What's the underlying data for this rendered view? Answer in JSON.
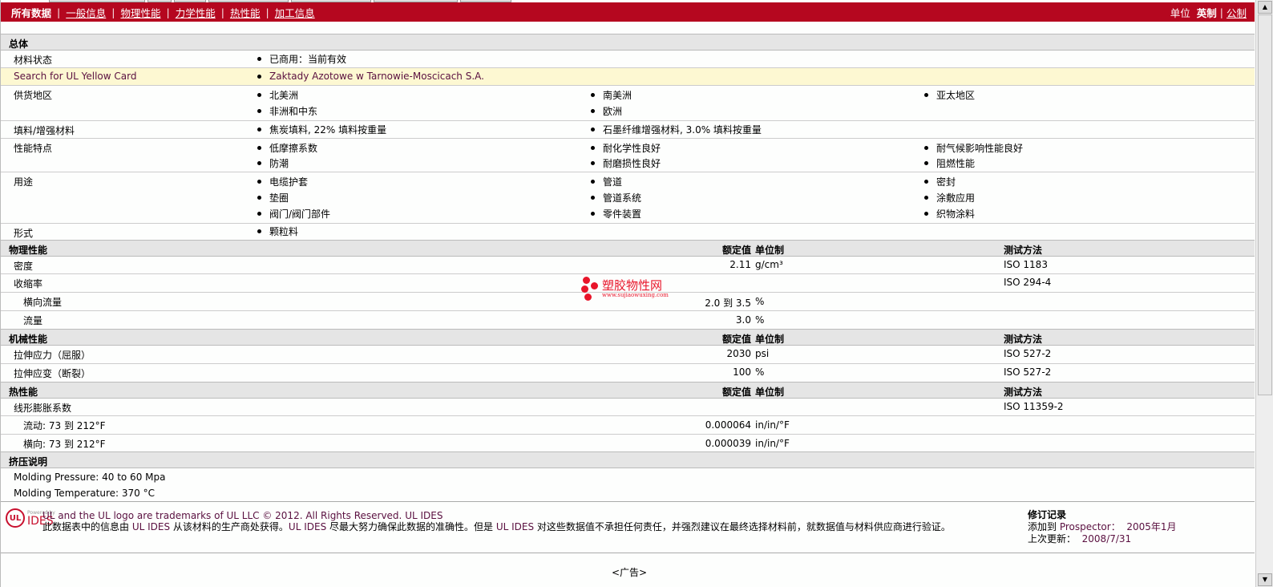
{
  "nav": {
    "items": [
      "所有数据",
      "一般信息",
      "物理性能",
      "力学性能",
      "热性能",
      "加工信息"
    ],
    "units_label": "单位",
    "units_current": "英制",
    "units_other": "公制"
  },
  "general": {
    "title": "总体",
    "status": {
      "label": "材料状态",
      "values": [
        "已商用：当前有效"
      ]
    },
    "yellow": {
      "label": "Search for UL Yellow Card",
      "values": [
        "Zaktady Azotowe w Tarnowie-Moscicach S.A."
      ]
    },
    "region": {
      "label": "供货地区",
      "values": [
        "北美洲",
        "南美洲",
        "亚太地区",
        "非洲和中东",
        "欧洲"
      ]
    },
    "filler": {
      "label": "填料/增强材料",
      "values": [
        "焦炭填料, 22% 填料按重量",
        "石墨纤维增强材料, 3.0% 填料按重量"
      ]
    },
    "features": {
      "label": "性能特点",
      "values": [
        "低摩擦系数",
        "耐化学性良好",
        "耐气候影响性能良好",
        "防潮",
        "耐磨损性良好",
        "阻燃性能"
      ]
    },
    "uses": {
      "label": "用途",
      "values": [
        "电缆护套",
        "管道",
        "密封",
        "垫圈",
        "管道系统",
        "涂敷应用",
        "阀门/阀门部件",
        "零件装置",
        "织物涂料"
      ]
    },
    "form": {
      "label": "形式",
      "values": [
        "颗粒料"
      ]
    }
  },
  "headers": {
    "value": "额定值",
    "unit": "单位制",
    "test": "测试方法"
  },
  "physical": {
    "title": "物理性能",
    "rows": [
      {
        "label": "密度",
        "value": "2.11",
        "unit": "g/cm³",
        "test": "ISO 1183"
      },
      {
        "label": "收缩率",
        "value": "",
        "unit": "",
        "test": "ISO 294-4"
      },
      {
        "label": "横向流量",
        "value": "2.0 到  3.5",
        "unit": "%",
        "test": ""
      },
      {
        "label": "流量",
        "value": "3.0",
        "unit": "%",
        "test": ""
      }
    ]
  },
  "mechanical": {
    "title": "机械性能",
    "rows": [
      {
        "label": "拉伸应力（屈服）",
        "value": "2030",
        "unit": "psi",
        "test": "ISO 527-2"
      },
      {
        "label": "拉伸应变（断裂）",
        "value": "100",
        "unit": "%",
        "test": "ISO 527-2"
      }
    ]
  },
  "thermal": {
    "title": "热性能",
    "rows": [
      {
        "label": "线形膨胀系数",
        "value": "",
        "unit": "",
        "test": "ISO 11359-2"
      },
      {
        "label": "流动: 73 到  212°F",
        "value": "0.000064",
        "unit": "in/in/°F",
        "test": ""
      },
      {
        "label": "横向: 73 到  212°F",
        "value": "0.000039",
        "unit": "in/in/°F",
        "test": ""
      }
    ]
  },
  "extrusion": {
    "title": "挤压说明",
    "lines": [
      "Molding Pressure: 40 to 60 Mpa",
      "Molding Temperature: 370 °C"
    ]
  },
  "watermark": {
    "name": "塑胶物性网",
    "url": "www.sujiaowuxing.com"
  },
  "footer": {
    "logo_ul": "UL",
    "logo_powered": "Powered by",
    "logo_ides": "IDES",
    "line1": "UL and the UL logo are trademarks of UL LLC © 2012. All Rights Reserved.",
    "line1_link": "UL IDES",
    "line2a": "此数据表中的信息由 ",
    "ides": "UL IDES",
    "line2b": " 从该材料的生产商处获得。",
    "line2c": " 尽最大努力确保此数据的准确性。但是 ",
    "line2d": " 对这些数据值不承担任何责任，并强烈建议在最终选择材料前，就数据值与材料供应商进行验证。",
    "rev_title": "修订记录",
    "added_label": "添加到",
    "prospector": "Prospector：",
    "added_date": "2005年1月",
    "updated_label": "上次更新：",
    "updated_date": "2008/7/31"
  },
  "ad": "<广告>"
}
